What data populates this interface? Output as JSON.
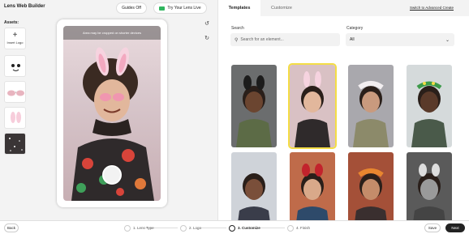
{
  "header": {
    "app_title": "Lens Web Builder",
    "guides_label": "Guides Off",
    "try_live_label": "Try Your Lens Live"
  },
  "assets": {
    "label": "Assets:",
    "insert_label": "Insert Logo"
  },
  "preview": {
    "crop_notice": "Area may be cropped on shorter devices"
  },
  "panel": {
    "tabs": [
      "Templates",
      "Customize"
    ],
    "active_tab": "Templates",
    "switch_link": "Switch to Advanced Create",
    "search_label": "Search",
    "search_placeholder": "Search for an element...",
    "category_label": "Category",
    "category_value": "All"
  },
  "templates": [
    {
      "accent": "black-ears",
      "bg": "#6b6d6e",
      "selected": false
    },
    {
      "accent": "bunny-ears",
      "bg": "#d9c1c4",
      "selected": true
    },
    {
      "accent": "flower-crown-white",
      "bg": "#a9a8ad",
      "selected": false
    },
    {
      "accent": "flower-crown-green",
      "bg": "#d5dadb",
      "selected": false
    },
    {
      "accent": "none",
      "bg": "#cfd3d9",
      "selected": false
    },
    {
      "accent": "red-bow-ears",
      "bg": "#bf6b4a",
      "selected": false
    },
    {
      "accent": "flower-crown-orange",
      "bg": "#a45038",
      "selected": false
    },
    {
      "accent": "grayscale-ears",
      "bg": "#5a5a5a",
      "selected": false
    }
  ],
  "footer": {
    "back_label": "Back",
    "steps": [
      "1. Lens Type",
      "2. Logo",
      "3. Customize",
      "4. Finish"
    ],
    "active_step": "3. Customize",
    "save_label": "Save",
    "next_label": "Next"
  },
  "colors": {
    "accent_yellow": "#f4dd46",
    "live_green": "#2fb55e",
    "next_bg": "#222222"
  }
}
